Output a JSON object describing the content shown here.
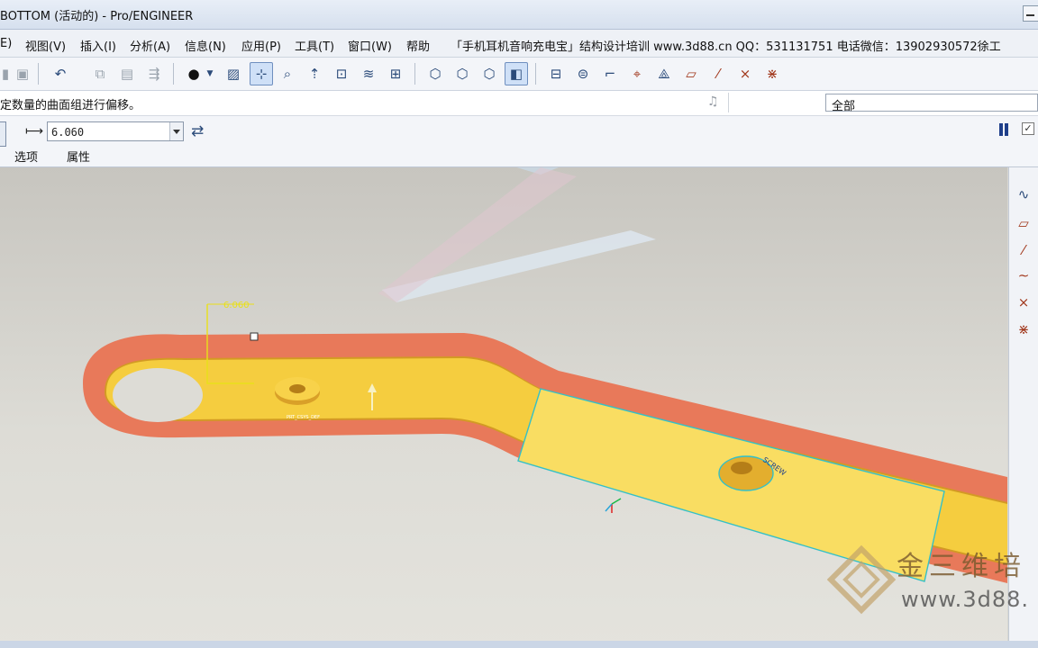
{
  "window": {
    "title": "BOTTOM (活动的) - Pro/ENGINEER"
  },
  "menubar": {
    "items": [
      {
        "label": "E)"
      },
      {
        "label": "视图(V)"
      },
      {
        "label": "插入(I)"
      },
      {
        "label": "分析(A)"
      },
      {
        "label": "信息(N)"
      },
      {
        "label": "应用(P)"
      },
      {
        "label": "工具(T)"
      },
      {
        "label": "窗口(W)"
      },
      {
        "label": "帮助"
      }
    ],
    "note": "「手机耳机音响充电宝」结构设计培训 www.3d88.cn   QQ：531131751 电话微信：13902930572徐工"
  },
  "toolbar": {
    "icons": [
      "new-icon",
      "save-icon",
      "undo-icon",
      "copy-icon",
      "paste-icon",
      "regenerate-icon",
      "shading-icon",
      "repaint-icon",
      "datum-display-icon",
      "zoom-window-icon",
      "orient-icon",
      "saved-views-icon",
      "layers-icon",
      "view-manager-icon",
      "wireframe-icon",
      "hidden-line-icon",
      "no-hidden-icon",
      "shaded-icon",
      "plane-datum-icon",
      "axis-datum-icon",
      "point-datum-icon",
      "csys-datum-icon",
      "spin-center-icon",
      "sketch-icon",
      "datum-plane-icon",
      "datum-axis-icon",
      "datum-point-icon",
      "datum-csys-icon"
    ]
  },
  "message": {
    "text": "定数量的曲面组进行偏移。",
    "filter": "全部"
  },
  "dashboard": {
    "offset_value": "6.060",
    "tabs": [
      "选项",
      "属性"
    ]
  },
  "viewport": {
    "dimension_label": "6.060",
    "part_labels": [
      "PRT_CSYS_DEF",
      "SCREW"
    ]
  },
  "watermark": {
    "brand": "金三维培",
    "url": "www.3d88."
  },
  "colors": {
    "part_fill": "#f2c23a",
    "part_top": "#f8da58",
    "rim": "#e8795a",
    "selection": "#35c0c7",
    "dimension": "#e9e01a",
    "brand": "#7a5a2e"
  }
}
